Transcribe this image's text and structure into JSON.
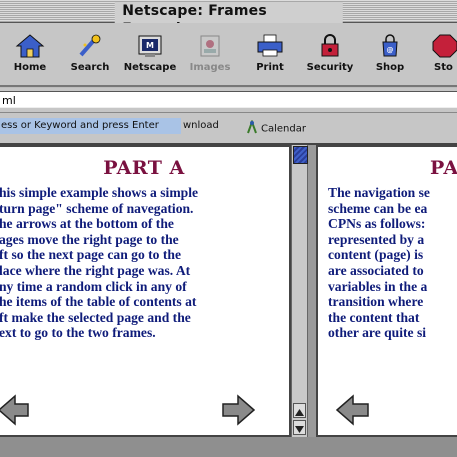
{
  "window": {
    "title": "Netscape: Frames Example"
  },
  "toolbar": {
    "buttons": [
      {
        "label": "Home",
        "icon": "home-icon",
        "enabled": true
      },
      {
        "label": "Search",
        "icon": "search-icon",
        "enabled": true
      },
      {
        "label": "Netscape",
        "icon": "netscape-icon",
        "enabled": true
      },
      {
        "label": "Images",
        "icon": "images-icon",
        "enabled": false
      },
      {
        "label": "Print",
        "icon": "print-icon",
        "enabled": true
      },
      {
        "label": "Security",
        "icon": "security-icon",
        "enabled": true
      },
      {
        "label": "Shop",
        "icon": "shop-icon",
        "enabled": true
      },
      {
        "label": "Sto",
        "icon": "stop-icon",
        "enabled": true
      }
    ]
  },
  "location": {
    "value": "ml"
  },
  "personal_toolbar": {
    "hint": "ess or Keyword and press Enter",
    "links": [
      {
        "label": "wnload"
      },
      {
        "label": "Calendar"
      }
    ]
  },
  "frames": {
    "left": {
      "title": "PART A",
      "lines": [
        "his simple example shows a simple",
        "turn page\" scheme of navegation.",
        "he arrows at the bottom of the",
        "ages move the right page to the",
        "ft so the next page can go to the",
        "lace where the right page was. At",
        "ny time a random click in any of",
        "he items of the table of contents at",
        "ft make the selected page and the",
        "ext to go to the two frames."
      ]
    },
    "right": {
      "title": "PART",
      "lines": [
        "The navigation se",
        "scheme can be ea",
        "CPNs as follows:",
        "represented by a",
        "content (page) is",
        "are associated to",
        "variables in the a",
        "transition where",
        "the content that",
        "other are quite si"
      ]
    }
  },
  "colors": {
    "heading": "#7a1140",
    "body_text": "#0f1c7a",
    "scroll_thumb": "#3a56c0"
  }
}
